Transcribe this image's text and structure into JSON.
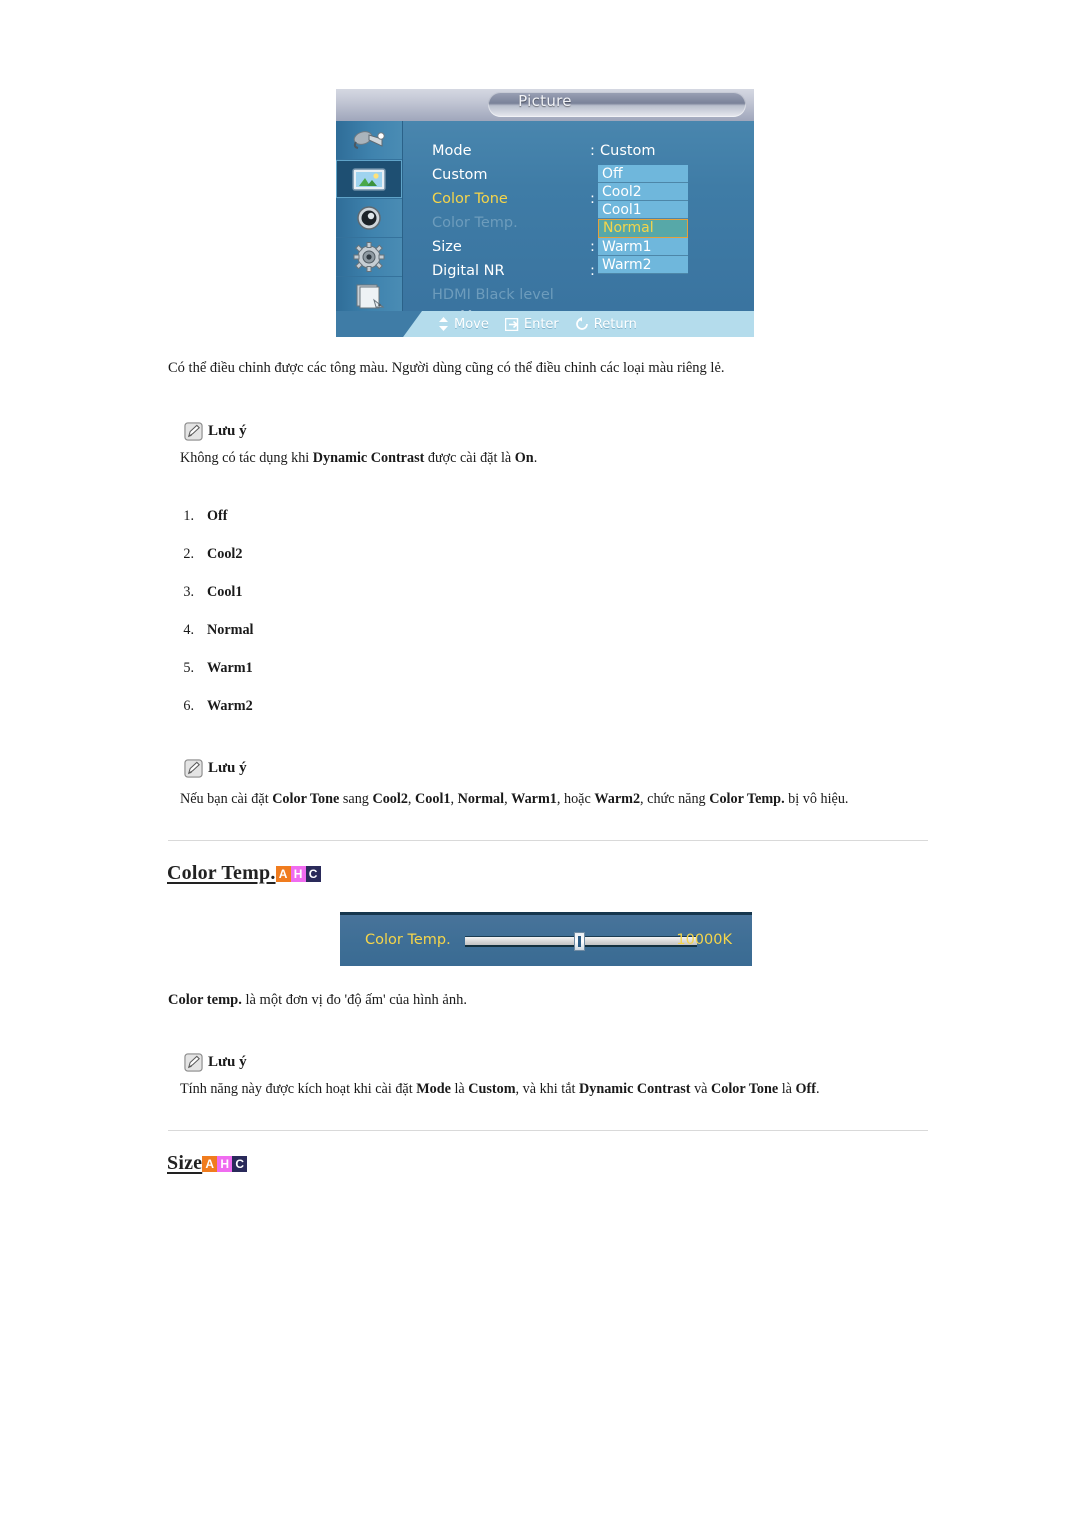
{
  "osd": {
    "title": "Picture",
    "sidebar_icons": [
      {
        "name": "input-source-icon",
        "selected": false
      },
      {
        "name": "picture-icon",
        "selected": true
      },
      {
        "name": "sound-speaker-icon",
        "selected": false
      },
      {
        "name": "setup-gear-icon",
        "selected": false
      },
      {
        "name": "multi-control-icon",
        "selected": false
      }
    ],
    "rows": [
      {
        "label": "Mode",
        "colon": ":",
        "value": "Custom",
        "state": "normal"
      },
      {
        "label": "Custom",
        "colon": "",
        "value": "",
        "state": "normal"
      },
      {
        "label": "Color Tone",
        "colon": ":",
        "value": "",
        "state": "active"
      },
      {
        "label": "Color Temp.",
        "colon": "",
        "value": "",
        "state": "disabled"
      },
      {
        "label": "Size",
        "colon": ":",
        "value": "",
        "state": "normal"
      },
      {
        "label": "Digital NR",
        "colon": ":",
        "value": "",
        "state": "normal"
      },
      {
        "label": "HDMI Black level",
        "colon": "",
        "value": "",
        "state": "disabled"
      },
      {
        "label": "More",
        "colon": "",
        "value": "",
        "state": "normal"
      }
    ],
    "dropdown": {
      "items": [
        "Off",
        "Cool2",
        "Cool1",
        "Normal",
        "Warm1",
        "Warm2"
      ],
      "selected": "Normal"
    },
    "bottom_hints": [
      {
        "icon": "updown-arrow-icon",
        "label": "Move"
      },
      {
        "icon": "enter-key-icon",
        "label": "Enter"
      },
      {
        "icon": "return-arrow-icon",
        "label": "Return"
      }
    ],
    "colors": {
      "body_bg": "#3f7ca6",
      "dropdown_bg": "#6fb7dc",
      "highlight_bg": "#57a8a8",
      "highlight_text": "#f5d54a",
      "bottom_bar": "#b4dcec"
    }
  },
  "intro_paragraph": "Có thể điều chỉnh được các tông màu. Người dùng cũng có thể điều chỉnh các loại màu riêng lẻ.",
  "note1": {
    "title": "Lưu ý",
    "body_parts": [
      {
        "text": "Không có tác dụng khi ",
        "bold": false
      },
      {
        "text": "Dynamic Contrast",
        "bold": true
      },
      {
        "text": " được cài đặt là ",
        "bold": false
      },
      {
        "text": "On",
        "bold": true
      },
      {
        "text": ".",
        "bold": false
      }
    ]
  },
  "color_tone_list": [
    {
      "num": "1.",
      "text": "Off"
    },
    {
      "num": "2.",
      "text": "Cool2"
    },
    {
      "num": "3.",
      "text": "Cool1"
    },
    {
      "num": "4.",
      "text": "Normal"
    },
    {
      "num": "5.",
      "text": "Warm1"
    },
    {
      "num": "6.",
      "text": "Warm2"
    }
  ],
  "note2": {
    "title": "Lưu ý",
    "body_parts": [
      {
        "text": "Nếu bạn cài đặt ",
        "bold": false
      },
      {
        "text": "Color Tone",
        "bold": true
      },
      {
        "text": " sang ",
        "bold": false
      },
      {
        "text": "Cool2",
        "bold": true
      },
      {
        "text": ", ",
        "bold": false
      },
      {
        "text": "Cool1",
        "bold": true
      },
      {
        "text": ", ",
        "bold": false
      },
      {
        "text": "Normal",
        "bold": true
      },
      {
        "text": ", ",
        "bold": false
      },
      {
        "text": "Warm1",
        "bold": true
      },
      {
        "text": ", hoặc ",
        "bold": false
      },
      {
        "text": "Warm2",
        "bold": true
      },
      {
        "text": ", chức năng ",
        "bold": false
      },
      {
        "text": "Color Temp.",
        "bold": true
      },
      {
        "text": " bị vô hiệu.",
        "bold": false
      }
    ]
  },
  "heading_color_temp": {
    "text": "Color Temp.",
    "badges": [
      {
        "letter": "A",
        "bg": "#f07c1e"
      },
      {
        "letter": "H",
        "bg": "#f06cf0"
      },
      {
        "letter": "C",
        "bg": "#2a2a5a"
      }
    ]
  },
  "slider": {
    "label": "Color Temp.",
    "value": "10000K",
    "position_percent": 47
  },
  "color_temp_paragraph_parts": [
    {
      "text": "Color temp.",
      "bold": true
    },
    {
      "text": " là một đơn vị đo 'độ ấm' của hình ảnh.",
      "bold": false
    }
  ],
  "note3": {
    "title": "Lưu ý",
    "body_parts": [
      {
        "text": "Tính năng này được kích hoạt khi cài đặt ",
        "bold": false
      },
      {
        "text": "Mode",
        "bold": true
      },
      {
        "text": " là ",
        "bold": false
      },
      {
        "text": "Custom",
        "bold": true
      },
      {
        "text": ", và khi tắt ",
        "bold": false
      },
      {
        "text": "Dynamic Contrast",
        "bold": true
      },
      {
        "text": " và ",
        "bold": false
      },
      {
        "text": "Color Tone",
        "bold": true
      },
      {
        "text": " là ",
        "bold": false
      },
      {
        "text": "Off",
        "bold": true
      },
      {
        "text": ".",
        "bold": false
      }
    ]
  },
  "heading_size": {
    "text": "Size",
    "badges": [
      {
        "letter": "A",
        "bg": "#f07c1e"
      },
      {
        "letter": "H",
        "bg": "#f06cf0"
      },
      {
        "letter": "C",
        "bg": "#2a2a5a"
      }
    ]
  }
}
